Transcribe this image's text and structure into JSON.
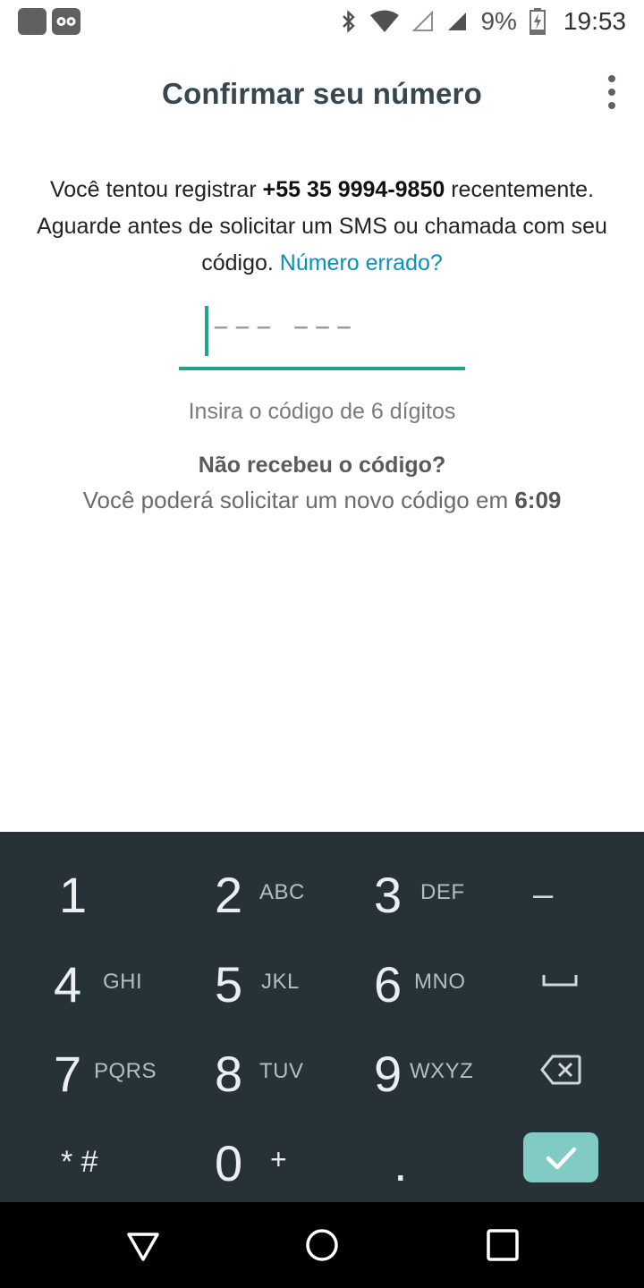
{
  "status_bar": {
    "battery_text": "9%",
    "time": "19:53",
    "icons": [
      "app-notification-icon",
      "infinity-icon",
      "bluetooth-icon",
      "wifi-icon",
      "signal-empty-icon",
      "signal-icon",
      "battery-charging-icon"
    ]
  },
  "app_bar": {
    "title": "Confirmar seu número",
    "menu_icon": "more-vert-icon"
  },
  "intro": {
    "prefix": "Você tentou registrar ",
    "phone": "+55 35 9994-9850",
    "middle": " recentemente. Aguarde antes de solicitar um SMS ou chamada com seu código. ",
    "wrong_number_link": "Número errado?"
  },
  "code_field": {
    "placeholder": "––– –––"
  },
  "hint": "Insira o código de 6 dígitos",
  "resend": {
    "title": "Não recebeu o código?",
    "message_prefix": "Você poderá solicitar um novo código em ",
    "countdown": "6:09"
  },
  "keypad": {
    "keys": [
      {
        "num": "1",
        "letters": ""
      },
      {
        "num": "2",
        "letters": "ABC"
      },
      {
        "num": "3",
        "letters": "DEF"
      },
      {
        "num": "4",
        "letters": "GHI"
      },
      {
        "num": "5",
        "letters": "JKL"
      },
      {
        "num": "6",
        "letters": "MNO"
      },
      {
        "num": "7",
        "letters": "PQRS"
      },
      {
        "num": "8",
        "letters": "TUV"
      },
      {
        "num": "9",
        "letters": "WXYZ"
      },
      {
        "num": "* #",
        "letters": ""
      },
      {
        "num": "0",
        "letters": "+"
      },
      {
        "num": ".",
        "letters": ""
      }
    ],
    "minus_label": "–",
    "confirm_color": "#80cbc4"
  },
  "colors": {
    "accent": "#1ea58c",
    "link": "#0b8fb8",
    "keypad_bg": "#263238"
  }
}
